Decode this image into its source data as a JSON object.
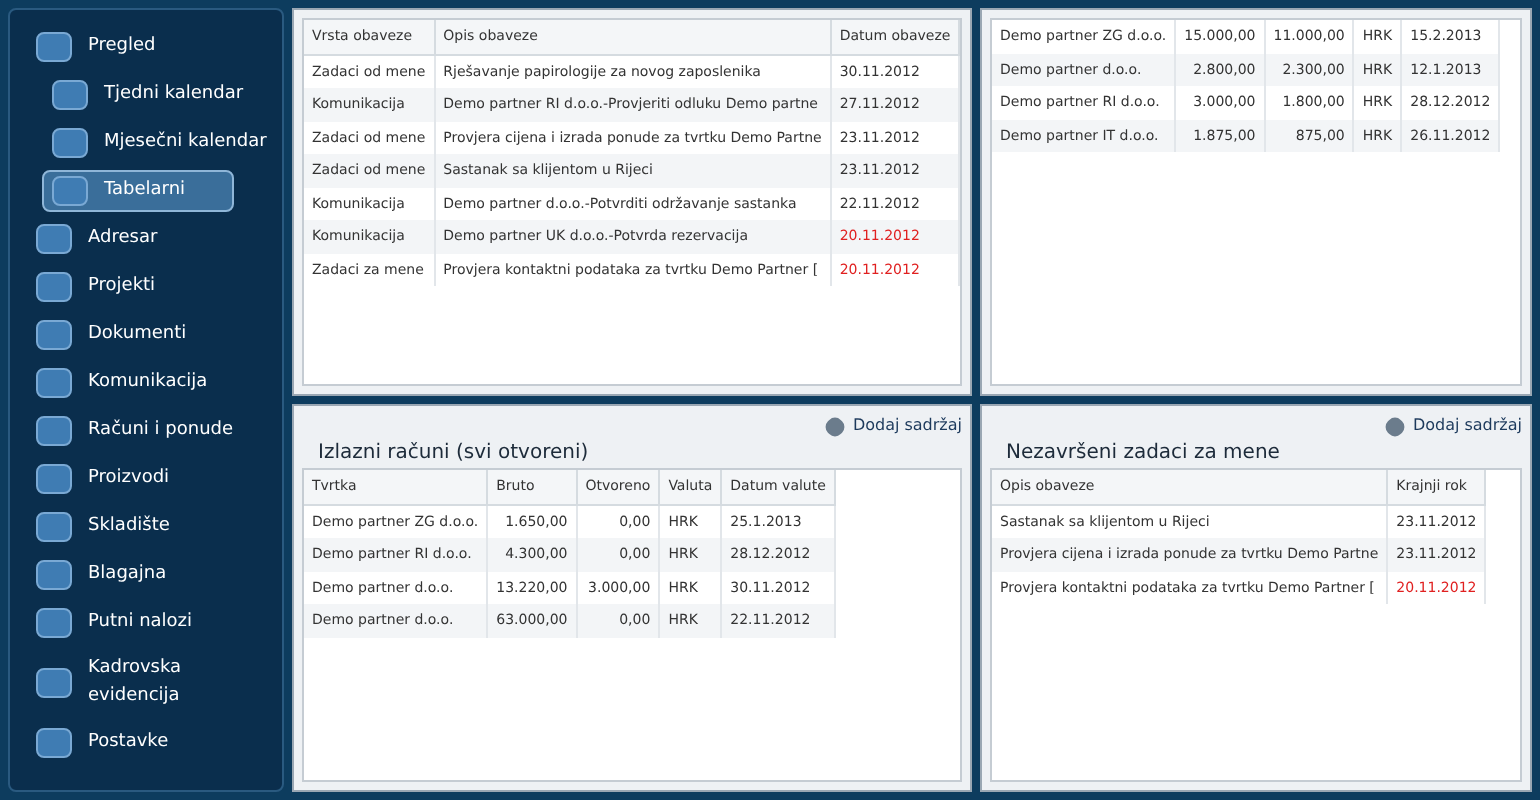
{
  "sidebar": {
    "items": [
      {
        "label": "Pregled",
        "selected": false,
        "children": [
          {
            "label": "Tjedni kalendar",
            "selected": false
          },
          {
            "label": "Mjesečni kalendar",
            "selected": false
          },
          {
            "label": "Tabelarni",
            "selected": true
          }
        ]
      },
      {
        "label": "Adresar",
        "selected": false
      },
      {
        "label": "Projekti",
        "selected": false
      },
      {
        "label": "Dokumenti",
        "selected": false
      },
      {
        "label": "Komunikacija",
        "selected": false
      },
      {
        "label": "Računi i ponude",
        "selected": false
      },
      {
        "label": "Proizvodi",
        "selected": false
      },
      {
        "label": "Skladište",
        "selected": false
      },
      {
        "label": "Blagajna",
        "selected": false
      },
      {
        "label": "Putni nalozi",
        "selected": false
      },
      {
        "label": "Kadrovska evidencija",
        "selected": false
      },
      {
        "label": "Postavke",
        "selected": false
      }
    ]
  },
  "panels": [
    {
      "columns": [
        "Vrsta obaveze",
        "Opis obaveze",
        "Datum obaveze"
      ],
      "rows": [
        {
          "cells": [
            "Zadaci od mene",
            "Rješavanje papirologije za novog zaposlenika",
            "30.11.2012"
          ],
          "overdue": false
        },
        {
          "cells": [
            "Komunikacija",
            "Demo partner RI d.o.o.-Provjeriti odluku Demo partne",
            "27.11.2012"
          ],
          "overdue": false
        },
        {
          "cells": [
            "Zadaci od mene",
            "Provjera cijena i izrada ponude za tvrtku Demo Partne",
            "23.11.2012"
          ],
          "overdue": false
        },
        {
          "cells": [
            "Zadaci od mene",
            "Sastanak sa klijentom u Rijeci",
            "23.11.2012"
          ],
          "overdue": false
        },
        {
          "cells": [
            "Komunikacija",
            "Demo partner d.o.o.-Potvrditi održavanje sastanka",
            "22.11.2012"
          ],
          "overdue": false
        },
        {
          "cells": [
            "Komunikacija",
            "Demo partner UK d.o.o.-Potvrda rezervacija",
            "20.11.2012"
          ],
          "overdue": true
        },
        {
          "cells": [
            "Zadaci za mene",
            "Provjera kontaktni podataka za tvrtku Demo Partner [",
            "20.11.2012"
          ],
          "overdue": true
        }
      ]
    },
    {
      "rows": [
        {
          "cells": [
            "Demo partner ZG d.o.o.",
            "15.000,00",
            "11.000,00",
            "HRK",
            "15.2.2013"
          ],
          "overdue": false
        },
        {
          "cells": [
            "Demo partner d.o.o.",
            "2.800,00",
            "2.300,00",
            "HRK",
            "12.1.2013"
          ],
          "overdue": false
        },
        {
          "cells": [
            "Demo partner RI d.o.o.",
            "3.000,00",
            "1.800,00",
            "HRK",
            "28.12.2012"
          ],
          "overdue": false
        },
        {
          "cells": [
            "Demo partner IT d.o.o.",
            "1.875,00",
            "875,00",
            "HRK",
            "26.11.2012"
          ],
          "overdue": false
        }
      ]
    },
    {
      "action": "Dodaj sadržaj",
      "title": "Izlazni računi (svi otvoreni)",
      "columns": [
        "Tvrtka",
        "Bruto",
        "Otvoreno",
        "Valuta",
        "Datum valute"
      ],
      "rows": [
        {
          "cells": [
            "Demo partner ZG d.o.o.",
            "1.650,00",
            "0,00",
            "HRK",
            "25.1.2013"
          ],
          "overdue": false
        },
        {
          "cells": [
            "Demo partner RI d.o.o.",
            "4.300,00",
            "0,00",
            "HRK",
            "28.12.2012"
          ],
          "overdue": false
        },
        {
          "cells": [
            "Demo partner d.o.o.",
            "13.220,00",
            "3.000,00",
            "HRK",
            "30.11.2012"
          ],
          "overdue": false
        },
        {
          "cells": [
            "Demo partner d.o.o.",
            "63.000,00",
            "0,00",
            "HRK",
            "22.11.2012"
          ],
          "overdue": false
        }
      ]
    },
    {
      "action": "Dodaj sadržaj",
      "title": "Nezavršeni zadaci za mene",
      "columns": [
        "Opis obaveze",
        "Krajnji rok"
      ],
      "rows": [
        {
          "cells": [
            "Sastanak sa klijentom u Rijeci",
            "23.11.2012"
          ],
          "overdue": false
        },
        {
          "cells": [
            "Provjera cijena i izrada ponude za tvrtku Demo Partne",
            "23.11.2012"
          ],
          "overdue": false
        },
        {
          "cells": [
            "Provjera kontaktni podataka za tvrtku Demo Partner [",
            "20.11.2012"
          ],
          "overdue": true
        }
      ]
    }
  ]
}
